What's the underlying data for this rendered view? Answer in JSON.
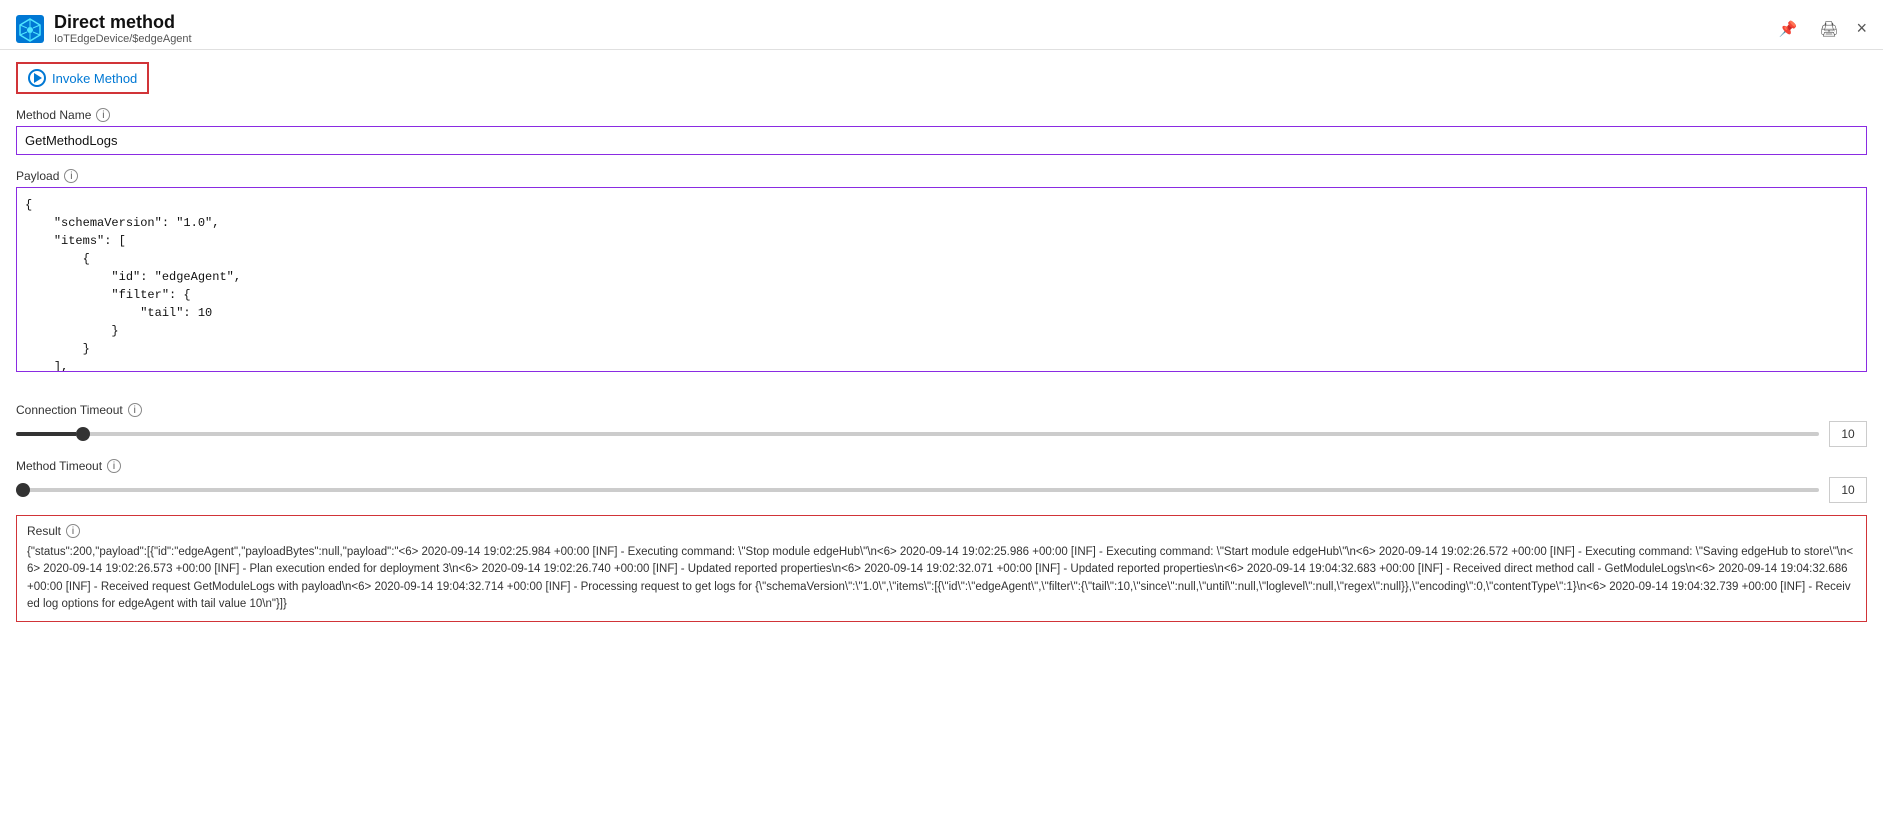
{
  "header": {
    "title": "Direct method",
    "subtitle": "IoTEdgeDevice/$edgeAgent",
    "pin_icon": "📌",
    "print_icon": "🖨",
    "close_label": "×"
  },
  "invoke_button": {
    "label": "Invoke Method"
  },
  "method_name": {
    "label": "Method Name",
    "value": "GetMethodLogs",
    "info_icon": "i"
  },
  "payload": {
    "label": "Payload",
    "info_icon": "i",
    "value": "{\n    \"schemaVersion\": \"1.0\",\n    \"items\": [\n        {\n            \"id\": \"edgeAgent\",\n            \"filter\": {\n                \"tail\": 10\n            }\n        }\n    ],"
  },
  "connection_timeout": {
    "label": "Connection Timeout",
    "info_icon": "i",
    "value": 10,
    "min": 0,
    "max": 300
  },
  "method_timeout": {
    "label": "Method Timeout",
    "info_icon": "i",
    "value": 10,
    "min": 0,
    "max": 300
  },
  "result": {
    "label": "Result",
    "info_icon": "i",
    "text": "{\"status\":200,\"payload\":[{\"id\":\"edgeAgent\",\"payloadBytes\":null,\"payload\":\"<6> 2020-09-14 19:02:25.984 +00:00 [INF] - Executing command: \\\"Stop module edgeHub\\\"\\n<6> 2020-09-14 19:02:25.986 +00:00 [INF] - Executing command: \\\"Start module edgeHub\\\"\\n<6> 2020-09-14 19:02:26.572 +00:00 [INF] - Executing command: \\\"Saving edgeHub to store\\\"\\n<6> 2020-09-14 19:02:26.573 +00:00 [INF] - Plan execution ended for deployment 3\\n<6> 2020-09-14 19:02:26.740 +00:00 [INF] - Updated reported properties\\n<6> 2020-09-14 19:02:32.071 +00:00 [INF] - Updated reported properties\\n<6> 2020-09-14 19:04:32.683 +00:00 [INF] - Received direct method call - GetModuleLogs\\n<6> 2020-09-14 19:04:32.686 +00:00 [INF] - Received request GetModuleLogs with payload\\n<6> 2020-09-14 19:04:32.714 +00:00 [INF] - Processing request to get logs for {\\\"schemaVersion\\\":\\\"1.0\\\",\\\"items\\\":[{\\\"id\\\":\\\"edgeAgent\\\",\\\"filter\\\":{\\\"tail\\\":10,\\\"since\\\":null,\\\"until\\\":null,\\\"loglevel\\\":null,\\\"regex\\\":null}},\\\"encoding\\\":0,\\\"contentType\\\":1}\\n<6> 2020-09-14 19:04:32.739 +00:00 [INF] - Received log options for edgeAgent with tail value 10\\n\"}]}"
  }
}
